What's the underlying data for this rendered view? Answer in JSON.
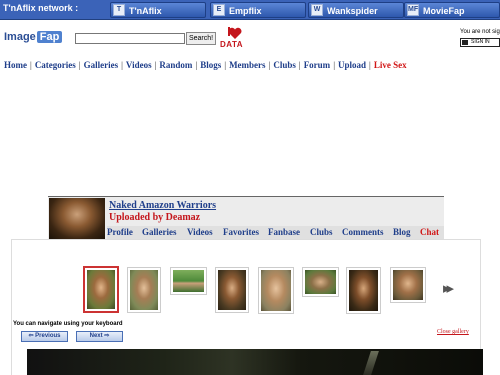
{
  "network": {
    "label": "T'nAflix network :",
    "sites": [
      {
        "icon": "T",
        "label": "T'nAflix"
      },
      {
        "icon": "E",
        "label": "Empflix"
      },
      {
        "icon": "W",
        "label": "Wankspider"
      },
      {
        "icon": "MF",
        "label": "MovieFap"
      }
    ]
  },
  "header": {
    "logo_part1": "Image",
    "logo_part2": "Fap",
    "search_placeholder": "",
    "search_button": "Search!",
    "data_badge": "DATA",
    "login_note": "You are not sig",
    "signin_label": "SIGN IN"
  },
  "main_nav": [
    "Home",
    "Categories",
    "Galleries",
    "Videos",
    "Random",
    "Blogs",
    "Members",
    "Clubs",
    "Forum",
    "Upload",
    "Live Sex"
  ],
  "gallery": {
    "title": "Naked Amazon Warriors",
    "uploaded_by": "Uploaded by Deamaz",
    "subnav": [
      "Profile",
      "Galleries",
      "Videos",
      "Favorites",
      "Fanbase",
      "Clubs",
      "Comments",
      "Blog",
      "Chat"
    ],
    "keyboard_note": "You can navigate using your keyboard",
    "previous_label": "Previous",
    "next_label": "Next",
    "close_label": "Close gallery",
    "more_arrows": "▸▸"
  },
  "colors": {
    "link_blue": "#1f3e8a",
    "accent_red": "#c4161c",
    "network_bar": "#3b63b8"
  }
}
